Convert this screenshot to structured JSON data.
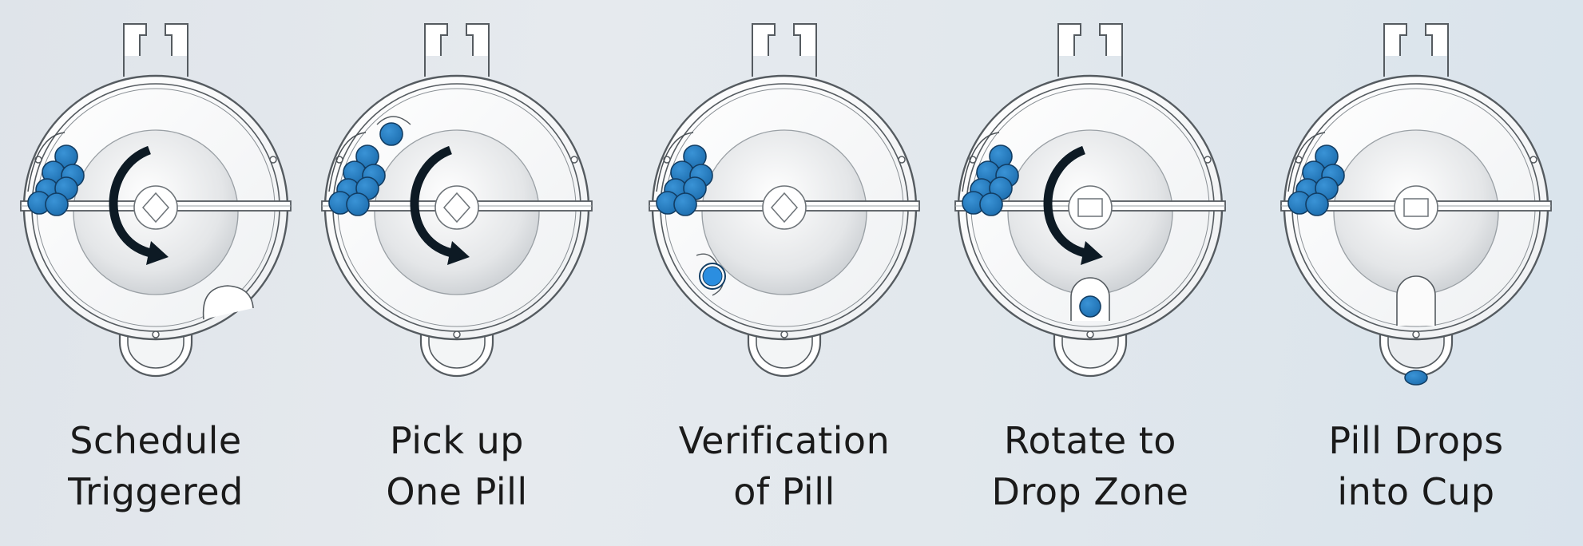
{
  "colors": {
    "pill": "#1e6fb0",
    "pill_highlight": "#3a93d6",
    "pill_verified": "#2b8ee0",
    "arrow": "#0d1a24",
    "outline": "#555b60",
    "background": "#e3e8ed"
  },
  "steps": [
    {
      "line1": "Schedule",
      "line2": "Triggered",
      "state": "schedule",
      "arrow": true,
      "icon": "rotation-arrow-icon"
    },
    {
      "line1": "Pick up",
      "line2": "One Pill",
      "state": "pickup",
      "arrow": true,
      "icon": "rotation-arrow-icon"
    },
    {
      "line1": "Verification",
      "line2": "of Pill",
      "state": "verify",
      "arrow": false,
      "icon": "pill-icon"
    },
    {
      "line1": "Rotate to",
      "line2": "Drop Zone",
      "state": "rotate",
      "arrow": true,
      "icon": "rotation-arrow-icon"
    },
    {
      "line1": "Pill Drops",
      "line2": "into Cup",
      "state": "drop",
      "arrow": false,
      "icon": "pill-icon"
    }
  ]
}
